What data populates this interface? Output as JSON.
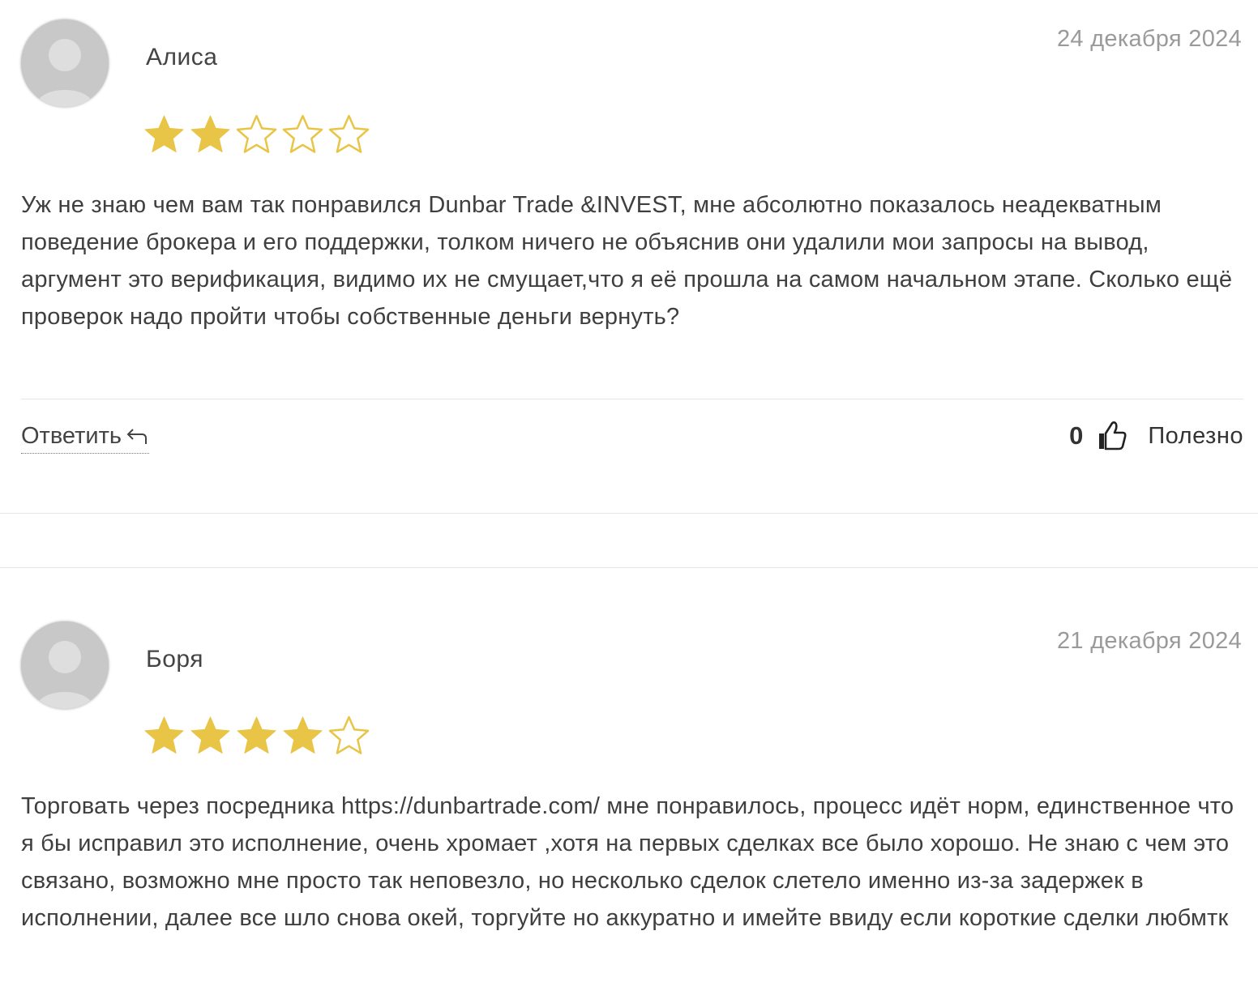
{
  "reviews": [
    {
      "author": "Алиса",
      "date": "24 декабря 2024",
      "rating": 2,
      "max_rating": 5,
      "text": "Уж не знаю чем вам так понравился Dunbar Trade &INVEST, мне абсолютно показалось неадекватным поведение брокера и его поддержки, толком ничего не объяснив они удалили мои запросы на вывод, аргумент это верификация, видимо их не смущает,что я её прошла на самом начальном этапе. Сколько ещё проверок надо пройти чтобы собственные деньги вернуть?",
      "reply_label": "Ответить",
      "likes": "0",
      "useful_label": "Полезно"
    },
    {
      "author": "Боря",
      "date": "21 декабря 2024",
      "rating": 4,
      "max_rating": 5,
      "text": "Торговать через посредника https://dunbartrade.com/ мне понравилось, процесс идёт норм, единственное что я бы исправил это исполнение, очень хромает ,хотя на первых сделках все было хорошо. Не знаю с чем это связано, возможно мне просто так неповезло, но несколько сделок слетело именно из-за задержек в исполнении, далее все шло снова окей, торгуйте но аккуратно и имейте ввиду если короткие сделки любмтк"
    }
  ],
  "colors": {
    "star_filled": "#e8c547",
    "star_outline": "#e8c547",
    "date": "#9a9a9a",
    "text": "#3f3f3f",
    "divider": "#e6e6e6"
  },
  "icons": {
    "avatar": "user-silhouette-icon",
    "star": "star-icon",
    "reply": "reply-arrow-icon",
    "like": "thumbs-up-icon"
  }
}
